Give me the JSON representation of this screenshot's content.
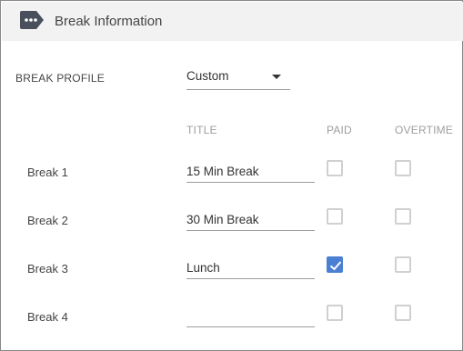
{
  "header": {
    "title": "Break Information",
    "icon": "more-horiz-tag-icon"
  },
  "profile": {
    "label": "BREAK PROFILE",
    "selected": "Custom"
  },
  "columns": {
    "title": "TITLE",
    "paid": "PAID",
    "overtime": "OVERTIME"
  },
  "breaks": [
    {
      "label": "Break 1",
      "title": "15 Min Break",
      "paid": false,
      "overtime": false
    },
    {
      "label": "Break 2",
      "title": "30 Min Break",
      "paid": false,
      "overtime": false
    },
    {
      "label": "Break 3",
      "title": "Lunch",
      "paid": true,
      "overtime": false
    },
    {
      "label": "Break 4",
      "title": "",
      "paid": false,
      "overtime": false
    }
  ],
  "colors": {
    "accent": "#4a7fd4",
    "header_bg": "#f2f2f2",
    "icon": "#4a4f5c"
  }
}
